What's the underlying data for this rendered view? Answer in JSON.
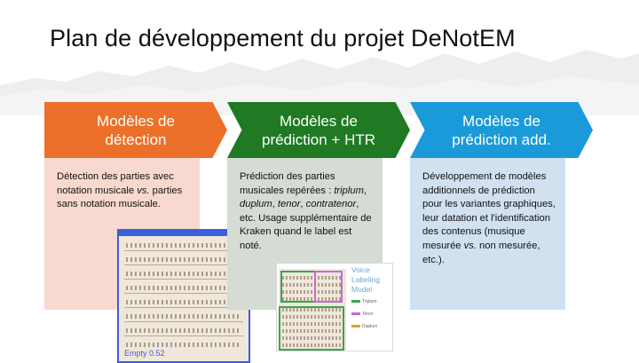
{
  "slide": {
    "title": "Plan de développement du projet DeNotEM"
  },
  "columns": [
    {
      "header": [
        "Modèles de",
        "détection"
      ],
      "color": "#ec7029",
      "body_color": "#f8d9cf",
      "body": {
        "line1": "Détection des parties avec notation musicale ",
        "vs": "vs.",
        "line2": " parties sans notation musicale."
      },
      "thumbnail": {
        "label": "Empty 0.52"
      }
    },
    {
      "header": [
        "Modèles de",
        "prédiction + HTR"
      ],
      "color": "#1f7a23",
      "body_color": "#d4dcd3",
      "body": {
        "part1": "Prédiction des parties musicales repérées : ",
        "triplum": "triplum",
        "sep1": ", ",
        "duplum": "duplum",
        "sep2": ", ",
        "tenor": "tenor",
        "sep3": ", ",
        "contratenor": "contratenor",
        "part2": ", etc. Usage supplémentaire de Kraken quand le label est noté."
      },
      "thumbnail": {
        "title": "Voice Labeling Model",
        "legend": [
          "Triplum",
          "Tenor",
          "Duplum"
        ]
      }
    },
    {
      "header": [
        "Modèles de",
        "prédiction add."
      ],
      "color": "#1a9ad9",
      "body_color": "#d1e1ef",
      "body": {
        "part1": "Développement de modèles additionnels de prédiction pour les variantes graphiques, leur datation et l'identification des contenus (musique mesurée ",
        "vs": "vs.",
        "part2": " non mesurée, etc.)."
      }
    }
  ]
}
